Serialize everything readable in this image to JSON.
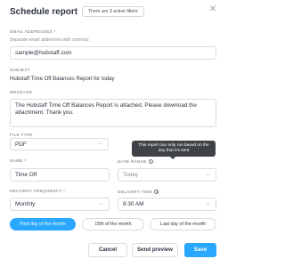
{
  "header": {
    "title": "Schedule report",
    "filters_badge": "There are 3 active filters",
    "close_icon": "close-icon"
  },
  "email": {
    "label": "EMAIL ADDRESSES *",
    "hint": "Separate email addresses with commas",
    "value": "sample@hubstaff.com"
  },
  "subject": {
    "label": "SUBJECT",
    "value": "Hubstaff Time Off Balances Report for today"
  },
  "message": {
    "label": "MESSAGE",
    "value": "The Hubstaff Time Off Balances Report is attached. Please download the attachment. Thank you."
  },
  "file_type": {
    "label": "FILE TYPE",
    "value": "PDF"
  },
  "tooltip": {
    "text": "This report can only run based on the day that it's sent"
  },
  "name": {
    "label": "NAME *",
    "value": "Time Off"
  },
  "date_range": {
    "label": "DATE RANGE",
    "value": "Today"
  },
  "delivery_frequency": {
    "label": "DELIVERY FREQUENCY *",
    "value": "Monthly"
  },
  "delivery_time": {
    "label": "DELIVERY TIME",
    "value": "8:30 AM"
  },
  "day_options": [
    {
      "label": "First day of the month",
      "active": true
    },
    {
      "label": "15th of the month",
      "active": false
    },
    {
      "label": "Last day of the month",
      "active": false
    }
  ],
  "actions": {
    "cancel": "Cancel",
    "preview": "Send preview",
    "save": "Save"
  },
  "colors": {
    "accent": "#2aa8ff",
    "tooltip_bg": "#3f4348"
  }
}
